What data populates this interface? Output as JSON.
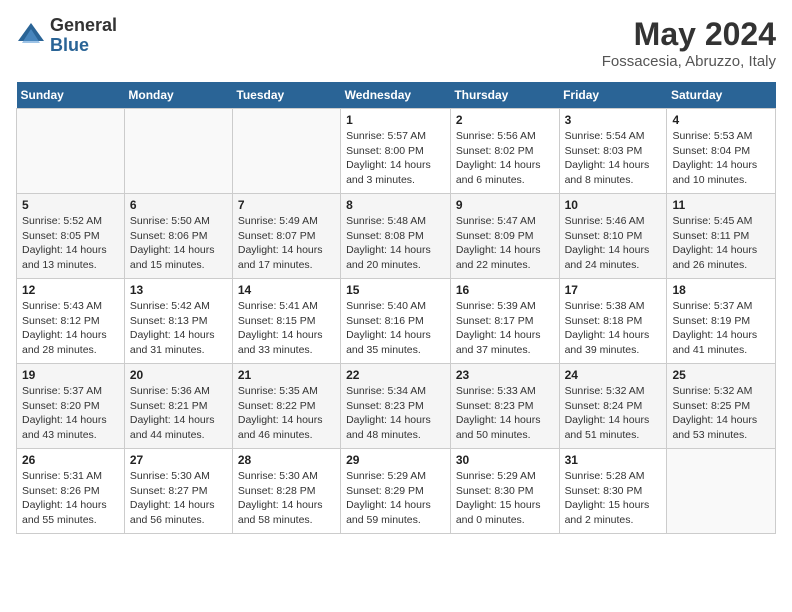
{
  "logo": {
    "general": "General",
    "blue": "Blue"
  },
  "title": "May 2024",
  "location": "Fossacesia, Abruzzo, Italy",
  "days_of_week": [
    "Sunday",
    "Monday",
    "Tuesday",
    "Wednesday",
    "Thursday",
    "Friday",
    "Saturday"
  ],
  "weeks": [
    [
      {
        "day": "",
        "info": ""
      },
      {
        "day": "",
        "info": ""
      },
      {
        "day": "",
        "info": ""
      },
      {
        "day": "1",
        "info": "Sunrise: 5:57 AM\nSunset: 8:00 PM\nDaylight: 14 hours\nand 3 minutes."
      },
      {
        "day": "2",
        "info": "Sunrise: 5:56 AM\nSunset: 8:02 PM\nDaylight: 14 hours\nand 6 minutes."
      },
      {
        "day": "3",
        "info": "Sunrise: 5:54 AM\nSunset: 8:03 PM\nDaylight: 14 hours\nand 8 minutes."
      },
      {
        "day": "4",
        "info": "Sunrise: 5:53 AM\nSunset: 8:04 PM\nDaylight: 14 hours\nand 10 minutes."
      }
    ],
    [
      {
        "day": "5",
        "info": "Sunrise: 5:52 AM\nSunset: 8:05 PM\nDaylight: 14 hours\nand 13 minutes."
      },
      {
        "day": "6",
        "info": "Sunrise: 5:50 AM\nSunset: 8:06 PM\nDaylight: 14 hours\nand 15 minutes."
      },
      {
        "day": "7",
        "info": "Sunrise: 5:49 AM\nSunset: 8:07 PM\nDaylight: 14 hours\nand 17 minutes."
      },
      {
        "day": "8",
        "info": "Sunrise: 5:48 AM\nSunset: 8:08 PM\nDaylight: 14 hours\nand 20 minutes."
      },
      {
        "day": "9",
        "info": "Sunrise: 5:47 AM\nSunset: 8:09 PM\nDaylight: 14 hours\nand 22 minutes."
      },
      {
        "day": "10",
        "info": "Sunrise: 5:46 AM\nSunset: 8:10 PM\nDaylight: 14 hours\nand 24 minutes."
      },
      {
        "day": "11",
        "info": "Sunrise: 5:45 AM\nSunset: 8:11 PM\nDaylight: 14 hours\nand 26 minutes."
      }
    ],
    [
      {
        "day": "12",
        "info": "Sunrise: 5:43 AM\nSunset: 8:12 PM\nDaylight: 14 hours\nand 28 minutes."
      },
      {
        "day": "13",
        "info": "Sunrise: 5:42 AM\nSunset: 8:13 PM\nDaylight: 14 hours\nand 31 minutes."
      },
      {
        "day": "14",
        "info": "Sunrise: 5:41 AM\nSunset: 8:15 PM\nDaylight: 14 hours\nand 33 minutes."
      },
      {
        "day": "15",
        "info": "Sunrise: 5:40 AM\nSunset: 8:16 PM\nDaylight: 14 hours\nand 35 minutes."
      },
      {
        "day": "16",
        "info": "Sunrise: 5:39 AM\nSunset: 8:17 PM\nDaylight: 14 hours\nand 37 minutes."
      },
      {
        "day": "17",
        "info": "Sunrise: 5:38 AM\nSunset: 8:18 PM\nDaylight: 14 hours\nand 39 minutes."
      },
      {
        "day": "18",
        "info": "Sunrise: 5:37 AM\nSunset: 8:19 PM\nDaylight: 14 hours\nand 41 minutes."
      }
    ],
    [
      {
        "day": "19",
        "info": "Sunrise: 5:37 AM\nSunset: 8:20 PM\nDaylight: 14 hours\nand 43 minutes."
      },
      {
        "day": "20",
        "info": "Sunrise: 5:36 AM\nSunset: 8:21 PM\nDaylight: 14 hours\nand 44 minutes."
      },
      {
        "day": "21",
        "info": "Sunrise: 5:35 AM\nSunset: 8:22 PM\nDaylight: 14 hours\nand 46 minutes."
      },
      {
        "day": "22",
        "info": "Sunrise: 5:34 AM\nSunset: 8:23 PM\nDaylight: 14 hours\nand 48 minutes."
      },
      {
        "day": "23",
        "info": "Sunrise: 5:33 AM\nSunset: 8:23 PM\nDaylight: 14 hours\nand 50 minutes."
      },
      {
        "day": "24",
        "info": "Sunrise: 5:32 AM\nSunset: 8:24 PM\nDaylight: 14 hours\nand 51 minutes."
      },
      {
        "day": "25",
        "info": "Sunrise: 5:32 AM\nSunset: 8:25 PM\nDaylight: 14 hours\nand 53 minutes."
      }
    ],
    [
      {
        "day": "26",
        "info": "Sunrise: 5:31 AM\nSunset: 8:26 PM\nDaylight: 14 hours\nand 55 minutes."
      },
      {
        "day": "27",
        "info": "Sunrise: 5:30 AM\nSunset: 8:27 PM\nDaylight: 14 hours\nand 56 minutes."
      },
      {
        "day": "28",
        "info": "Sunrise: 5:30 AM\nSunset: 8:28 PM\nDaylight: 14 hours\nand 58 minutes."
      },
      {
        "day": "29",
        "info": "Sunrise: 5:29 AM\nSunset: 8:29 PM\nDaylight: 14 hours\nand 59 minutes."
      },
      {
        "day": "30",
        "info": "Sunrise: 5:29 AM\nSunset: 8:30 PM\nDaylight: 15 hours\nand 0 minutes."
      },
      {
        "day": "31",
        "info": "Sunrise: 5:28 AM\nSunset: 8:30 PM\nDaylight: 15 hours\nand 2 minutes."
      },
      {
        "day": "",
        "info": ""
      }
    ]
  ]
}
